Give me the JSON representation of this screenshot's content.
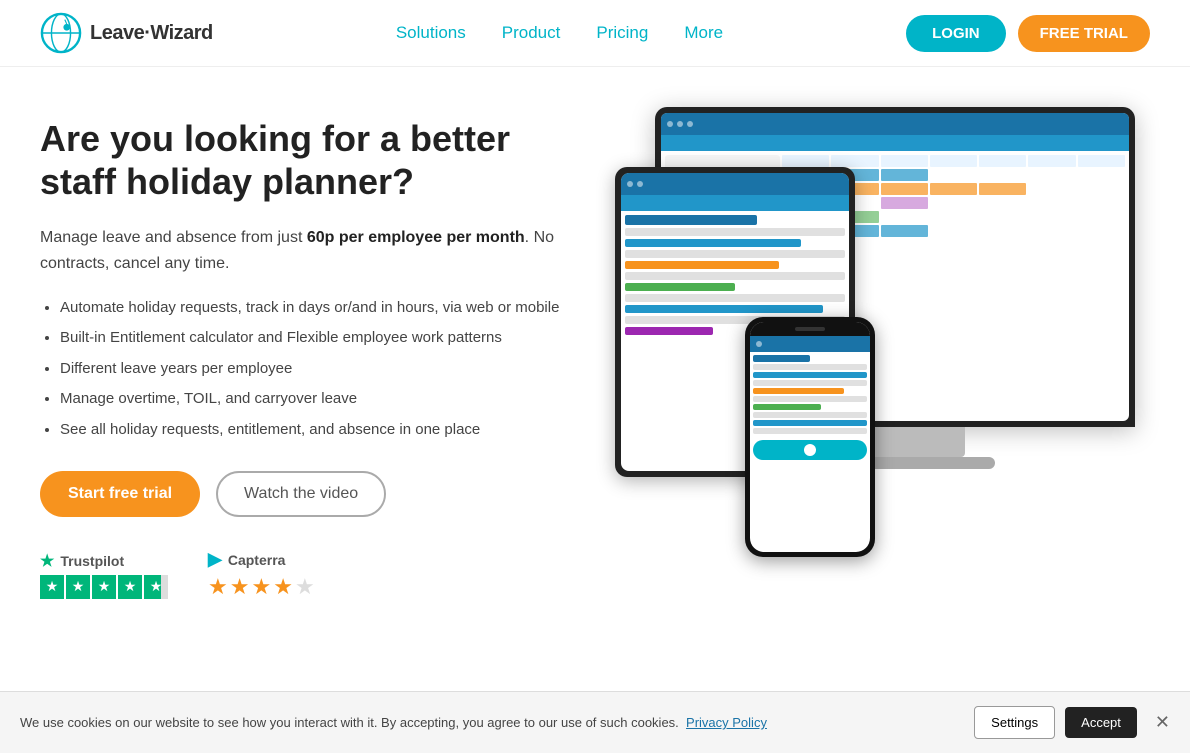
{
  "nav": {
    "logo_text": "Leave·Wizard",
    "links": [
      {
        "label": "Solutions",
        "id": "solutions"
      },
      {
        "label": "Product",
        "id": "product"
      },
      {
        "label": "Pricing",
        "id": "pricing"
      },
      {
        "label": "More",
        "id": "more"
      }
    ],
    "login_label": "LOGIN",
    "free_trial_label": "FREE TRIAL"
  },
  "hero": {
    "title": "Are you looking for a better staff holiday planner?",
    "subtitle_plain": "Manage leave and absence from just ",
    "subtitle_bold": "60p per employee per month",
    "subtitle_end": ". No contracts, cancel any time.",
    "list_items": [
      "Automate holiday requests, track in days or/and in hours, via web or mobile",
      "Built-in Entitlement calculator and Flexible employee work patterns",
      "Different leave years per employee",
      "Manage overtime, TOIL, and carryover leave",
      "See all holiday requests, entitlement, and absence in one place"
    ],
    "cta_primary": "Start free trial",
    "cta_secondary": "Watch the video"
  },
  "trust": {
    "trustpilot_label": "Trustpilot",
    "capterra_label": "Capterra",
    "trustpilot_stars": 4.5,
    "capterra_stars": 4
  },
  "cookie": {
    "message": "We use cookies on our website to see how you interact with it. By accepting, you agree to our use of such cookies.",
    "link_text": "Privacy Policy",
    "settings_label": "Settings",
    "accept_label": "Accept"
  }
}
